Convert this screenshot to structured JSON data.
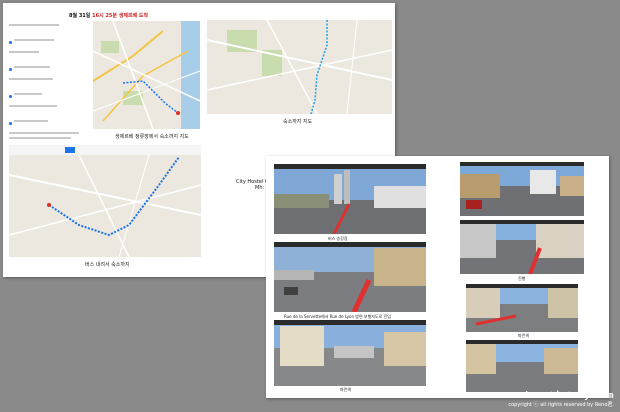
{
  "page1": {
    "title_date": "8월 31일",
    "title_time": "16시 25분",
    "title_bus": "생제르베 도착",
    "caption_top_right": "숙소까지 지도",
    "caption_left_map": "생제르베 정류장에서 숙소까지 지도",
    "caption_bottom_map": "버스 내려서 숙소까지",
    "side_text_line1": "City Hostel Ge",
    "side_text_line2": "Mh: A"
  },
  "page2": {
    "photo_captions": [
      "버스 승강장",
      "진행",
      "Rue de la Servette에서 Rue de Lyon 방면 보행자도로 진입",
      "파란색",
      "파란색"
    ]
  },
  "watermark": {
    "site": "zenokun.tistory.com",
    "copyright": "copyright ⓒ all rights reserved by Reno君."
  }
}
